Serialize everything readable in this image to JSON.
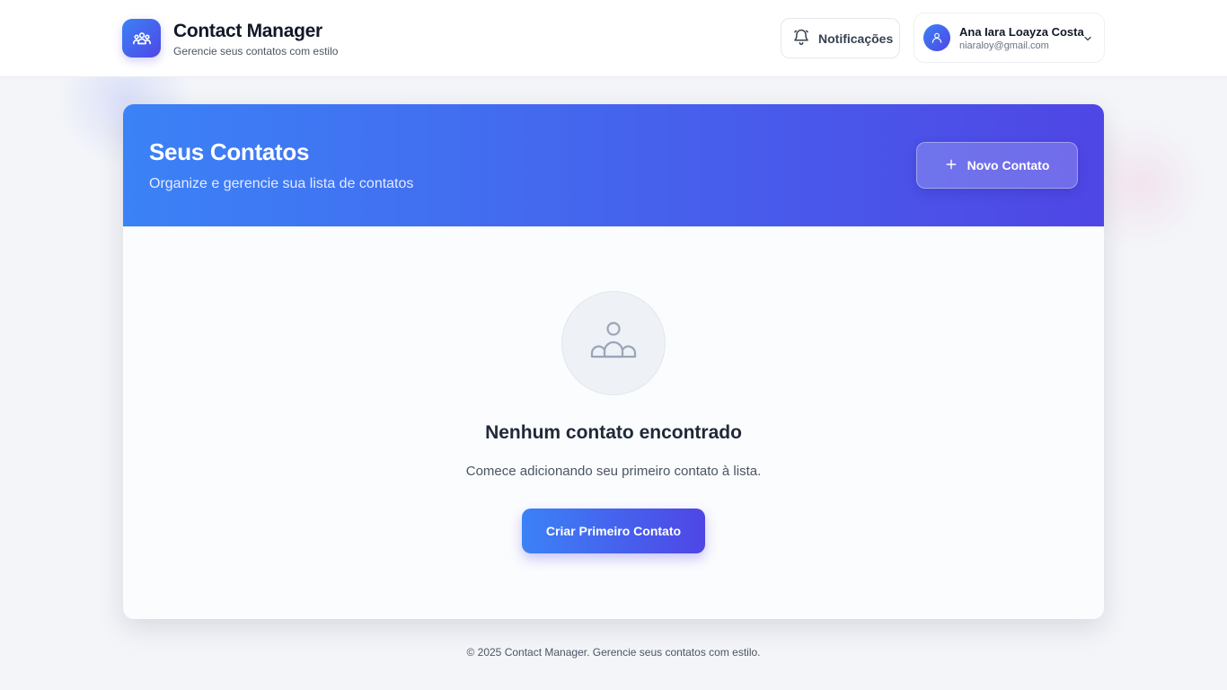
{
  "header": {
    "brand_title": "Contact Manager",
    "brand_subtitle": "Gerencie seus contatos com estilo",
    "brand_icon": "users-icon",
    "notifications_label": "Notificações",
    "notifications_icon": "bell-icon",
    "user": {
      "name": "Ana Iara Loayza Costa",
      "email": "niaraloy@gmail.com",
      "avatar_icon": "user-icon",
      "menu_icon": "chevron-down-icon"
    }
  },
  "main": {
    "title": "Seus Contatos",
    "subtitle": "Organize e gerencie sua lista de contatos",
    "new_contact_label": "Novo Contato",
    "new_contact_icon": "plus-icon",
    "empty_state": {
      "icon": "users-icon",
      "title": "Nenhum contato encontrado",
      "text": "Comece adicionando seu primeiro contato à lista.",
      "button_label": "Criar Primeiro Contato"
    }
  },
  "footer": {
    "text": "© 2025 Contact Manager. Gerencie seus contatos com estilo."
  },
  "colors": {
    "accent_start": "#3b82f6",
    "accent_end": "#4f46e5",
    "background": "#f3f5f9"
  }
}
